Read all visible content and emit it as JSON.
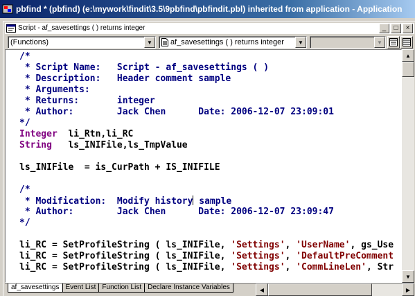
{
  "app": {
    "title": "pbfind * (pbfind) (e:\\mywork\\findit\\3.5\\9pbfind\\pbfindit.pbl) inherited from application - Application"
  },
  "script_window": {
    "title": "Script - af_savesettings ( ) returns integer",
    "buttons": {
      "minimize": "_",
      "maximize": "□",
      "close": "×"
    }
  },
  "toolbar": {
    "object_dropdown": {
      "value": "(Functions)"
    },
    "event_dropdown": {
      "value": "af_savesettings ( )  returns integer"
    },
    "third_dropdown": {
      "value": ""
    }
  },
  "editor": {
    "lines": [
      [
        {
          "t": "/*",
          "c": "comment"
        }
      ],
      [
        {
          "t": " * Script Name:   Script - af_savesettings ( )",
          "c": "comment"
        }
      ],
      [
        {
          "t": " * Description:   Header comment sample",
          "c": "comment"
        }
      ],
      [
        {
          "t": " * Arguments:",
          "c": "comment"
        }
      ],
      [
        {
          "t": " * Returns:       integer",
          "c": "comment"
        }
      ],
      [
        {
          "t": " * Author:        Jack Chen      Date: 2006-12-07 23:09:01",
          "c": "comment"
        }
      ],
      [
        {
          "t": "*/",
          "c": "comment"
        }
      ],
      [
        {
          "t": "Integer",
          "c": "type"
        },
        {
          "t": "  li_Rtn,li_RC",
          "c": "plain"
        }
      ],
      [
        {
          "t": "String",
          "c": "type"
        },
        {
          "t": "   ls_INIFile,ls_TmpValue",
          "c": "plain"
        }
      ],
      [],
      [
        {
          "t": "ls_INIFile  = is_CurPath + IS_INIFILE",
          "c": "plain"
        }
      ],
      [],
      [
        {
          "t": "/*",
          "c": "comment"
        }
      ],
      [
        {
          "t": " * Modification:  Modify history",
          "c": "comment"
        },
        {
          "t": "",
          "c": "caret"
        },
        {
          "t": " sample",
          "c": "comment"
        }
      ],
      [
        {
          "t": " * Author:        Jack Chen      Date: 2006-12-07 23:09:47",
          "c": "comment"
        }
      ],
      [
        {
          "t": "*/",
          "c": "comment"
        }
      ],
      [],
      [
        {
          "t": "li_RC = SetProfileString ( ls_INIFile, ",
          "c": "plain"
        },
        {
          "t": "'Settings'",
          "c": "str"
        },
        {
          "t": ", ",
          "c": "plain"
        },
        {
          "t": "'UserName'",
          "c": "str"
        },
        {
          "t": ", gs_Use",
          "c": "plain"
        }
      ],
      [
        {
          "t": "li_RC = SetProfileString ( ls_INIFile, ",
          "c": "plain"
        },
        {
          "t": "'Settings'",
          "c": "str"
        },
        {
          "t": ", ",
          "c": "plain"
        },
        {
          "t": "'DefaultPreComment",
          "c": "str"
        }
      ],
      [
        {
          "t": "li_RC = SetProfileString ( ls_INIFile, ",
          "c": "plain"
        },
        {
          "t": "'Settings'",
          "c": "str"
        },
        {
          "t": ", ",
          "c": "plain"
        },
        {
          "t": "'CommLineLen'",
          "c": "str"
        },
        {
          "t": ", Str",
          "c": "plain"
        }
      ]
    ]
  },
  "tabs": [
    {
      "label": "af_savesettings",
      "active": true
    },
    {
      "label": "Event List",
      "active": false
    },
    {
      "label": "Function List",
      "active": false
    },
    {
      "label": "Declare Instance Variables",
      "active": false
    }
  ],
  "colors": {
    "comment": "#000080",
    "type": "#800080",
    "string": "#800000",
    "title_bar_start": "#0a246a",
    "title_bar_end": "#a6caf0"
  }
}
